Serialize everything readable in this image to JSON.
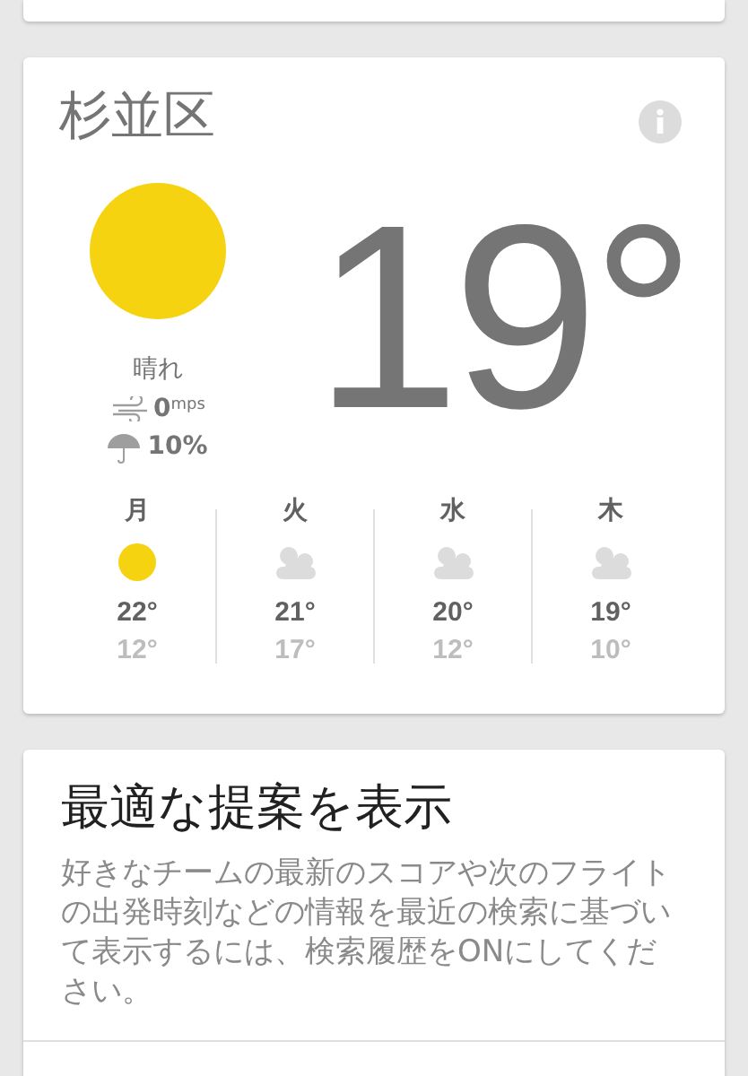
{
  "weather": {
    "location": "杉並区",
    "condition": {
      "kind": "sun",
      "label": "晴れ"
    },
    "wind": "0",
    "wind_unit": "mps",
    "precipitation": "10%",
    "temperature": "19°",
    "forecast": [
      {
        "day": "月",
        "kind": "sun",
        "high": "22°",
        "low": "12°"
      },
      {
        "day": "火",
        "kind": "cloud",
        "high": "21°",
        "low": "17°"
      },
      {
        "day": "水",
        "kind": "cloud",
        "high": "20°",
        "low": "12°"
      },
      {
        "day": "木",
        "kind": "cloud",
        "high": "19°",
        "low": "10°"
      }
    ]
  },
  "suggestion": {
    "title": "最適な提案を表示",
    "body": "好きなチームの最新のスコアや次のフライトの出発時刻などの情報を最近の検索に基づいて表示するには、検索履歴をONにしてください。"
  }
}
